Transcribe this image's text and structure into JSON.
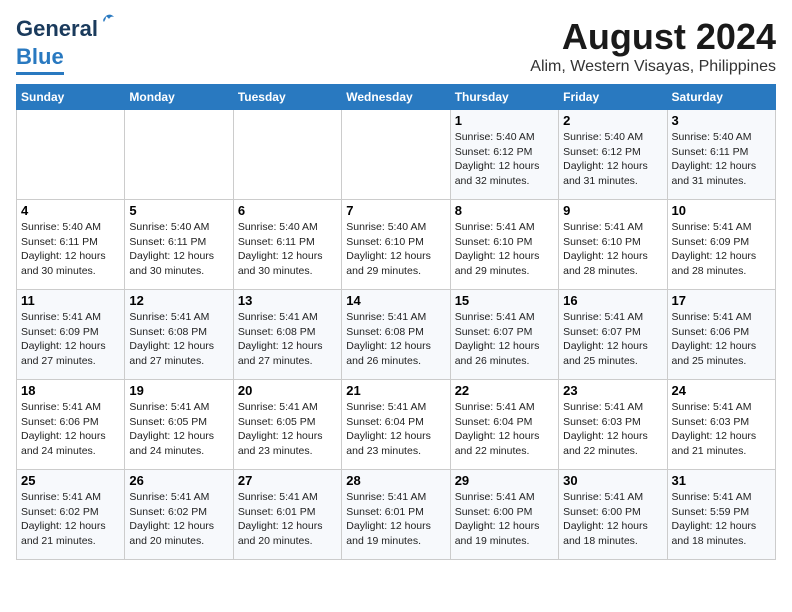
{
  "logo": {
    "general": "General",
    "blue": "Blue"
  },
  "header": {
    "title": "August 2024",
    "subtitle": "Alim, Western Visayas, Philippines"
  },
  "days_of_week": [
    "Sunday",
    "Monday",
    "Tuesday",
    "Wednesday",
    "Thursday",
    "Friday",
    "Saturday"
  ],
  "weeks": [
    [
      {
        "day": "",
        "content": ""
      },
      {
        "day": "",
        "content": ""
      },
      {
        "day": "",
        "content": ""
      },
      {
        "day": "",
        "content": ""
      },
      {
        "day": "1",
        "content": "Sunrise: 5:40 AM\nSunset: 6:12 PM\nDaylight: 12 hours\nand 32 minutes."
      },
      {
        "day": "2",
        "content": "Sunrise: 5:40 AM\nSunset: 6:12 PM\nDaylight: 12 hours\nand 31 minutes."
      },
      {
        "day": "3",
        "content": "Sunrise: 5:40 AM\nSunset: 6:11 PM\nDaylight: 12 hours\nand 31 minutes."
      }
    ],
    [
      {
        "day": "4",
        "content": "Sunrise: 5:40 AM\nSunset: 6:11 PM\nDaylight: 12 hours\nand 30 minutes."
      },
      {
        "day": "5",
        "content": "Sunrise: 5:40 AM\nSunset: 6:11 PM\nDaylight: 12 hours\nand 30 minutes."
      },
      {
        "day": "6",
        "content": "Sunrise: 5:40 AM\nSunset: 6:11 PM\nDaylight: 12 hours\nand 30 minutes."
      },
      {
        "day": "7",
        "content": "Sunrise: 5:40 AM\nSunset: 6:10 PM\nDaylight: 12 hours\nand 29 minutes."
      },
      {
        "day": "8",
        "content": "Sunrise: 5:41 AM\nSunset: 6:10 PM\nDaylight: 12 hours\nand 29 minutes."
      },
      {
        "day": "9",
        "content": "Sunrise: 5:41 AM\nSunset: 6:10 PM\nDaylight: 12 hours\nand 28 minutes."
      },
      {
        "day": "10",
        "content": "Sunrise: 5:41 AM\nSunset: 6:09 PM\nDaylight: 12 hours\nand 28 minutes."
      }
    ],
    [
      {
        "day": "11",
        "content": "Sunrise: 5:41 AM\nSunset: 6:09 PM\nDaylight: 12 hours\nand 27 minutes."
      },
      {
        "day": "12",
        "content": "Sunrise: 5:41 AM\nSunset: 6:08 PM\nDaylight: 12 hours\nand 27 minutes."
      },
      {
        "day": "13",
        "content": "Sunrise: 5:41 AM\nSunset: 6:08 PM\nDaylight: 12 hours\nand 27 minutes."
      },
      {
        "day": "14",
        "content": "Sunrise: 5:41 AM\nSunset: 6:08 PM\nDaylight: 12 hours\nand 26 minutes."
      },
      {
        "day": "15",
        "content": "Sunrise: 5:41 AM\nSunset: 6:07 PM\nDaylight: 12 hours\nand 26 minutes."
      },
      {
        "day": "16",
        "content": "Sunrise: 5:41 AM\nSunset: 6:07 PM\nDaylight: 12 hours\nand 25 minutes."
      },
      {
        "day": "17",
        "content": "Sunrise: 5:41 AM\nSunset: 6:06 PM\nDaylight: 12 hours\nand 25 minutes."
      }
    ],
    [
      {
        "day": "18",
        "content": "Sunrise: 5:41 AM\nSunset: 6:06 PM\nDaylight: 12 hours\nand 24 minutes."
      },
      {
        "day": "19",
        "content": "Sunrise: 5:41 AM\nSunset: 6:05 PM\nDaylight: 12 hours\nand 24 minutes."
      },
      {
        "day": "20",
        "content": "Sunrise: 5:41 AM\nSunset: 6:05 PM\nDaylight: 12 hours\nand 23 minutes."
      },
      {
        "day": "21",
        "content": "Sunrise: 5:41 AM\nSunset: 6:04 PM\nDaylight: 12 hours\nand 23 minutes."
      },
      {
        "day": "22",
        "content": "Sunrise: 5:41 AM\nSunset: 6:04 PM\nDaylight: 12 hours\nand 22 minutes."
      },
      {
        "day": "23",
        "content": "Sunrise: 5:41 AM\nSunset: 6:03 PM\nDaylight: 12 hours\nand 22 minutes."
      },
      {
        "day": "24",
        "content": "Sunrise: 5:41 AM\nSunset: 6:03 PM\nDaylight: 12 hours\nand 21 minutes."
      }
    ],
    [
      {
        "day": "25",
        "content": "Sunrise: 5:41 AM\nSunset: 6:02 PM\nDaylight: 12 hours\nand 21 minutes."
      },
      {
        "day": "26",
        "content": "Sunrise: 5:41 AM\nSunset: 6:02 PM\nDaylight: 12 hours\nand 20 minutes."
      },
      {
        "day": "27",
        "content": "Sunrise: 5:41 AM\nSunset: 6:01 PM\nDaylight: 12 hours\nand 20 minutes."
      },
      {
        "day": "28",
        "content": "Sunrise: 5:41 AM\nSunset: 6:01 PM\nDaylight: 12 hours\nand 19 minutes."
      },
      {
        "day": "29",
        "content": "Sunrise: 5:41 AM\nSunset: 6:00 PM\nDaylight: 12 hours\nand 19 minutes."
      },
      {
        "day": "30",
        "content": "Sunrise: 5:41 AM\nSunset: 6:00 PM\nDaylight: 12 hours\nand 18 minutes."
      },
      {
        "day": "31",
        "content": "Sunrise: 5:41 AM\nSunset: 5:59 PM\nDaylight: 12 hours\nand 18 minutes."
      }
    ]
  ]
}
